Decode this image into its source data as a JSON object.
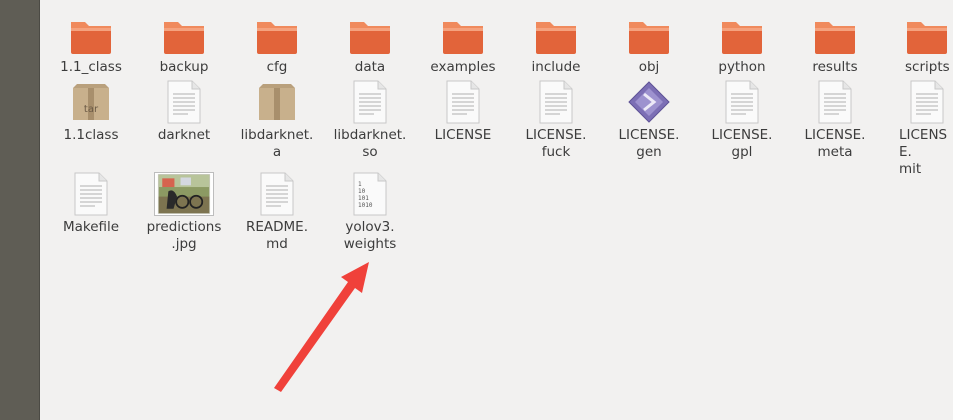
{
  "files": [
    {
      "name": "1.1_class",
      "type": "folder"
    },
    {
      "name": "backup",
      "type": "folder"
    },
    {
      "name": "cfg",
      "type": "folder"
    },
    {
      "name": "data",
      "type": "folder"
    },
    {
      "name": "examples",
      "type": "folder"
    },
    {
      "name": "include",
      "type": "folder"
    },
    {
      "name": "obj",
      "type": "folder"
    },
    {
      "name": "python",
      "type": "folder"
    },
    {
      "name": "results",
      "type": "folder"
    },
    {
      "name": "scripts",
      "type": "folder"
    },
    {
      "name": "1.1class",
      "type": "archive",
      "badge": "tar"
    },
    {
      "name": "darknet",
      "type": "document"
    },
    {
      "name": "libdarknet.\na",
      "type": "archive"
    },
    {
      "name": "libdarknet.\nso",
      "type": "document"
    },
    {
      "name": "LICENSE",
      "type": "document"
    },
    {
      "name": "LICENSE.\nfuck",
      "type": "document"
    },
    {
      "name": "LICENSE.\ngen",
      "type": "diamond"
    },
    {
      "name": "LICENSE.\ngpl",
      "type": "document"
    },
    {
      "name": "LICENSE.\nmeta",
      "type": "document"
    },
    {
      "name": "LICENSE.\nmit",
      "type": "document"
    },
    {
      "name": "Makefile",
      "type": "document"
    },
    {
      "name": "predictions\n.jpg",
      "type": "image"
    },
    {
      "name": "README.\nmd",
      "type": "document"
    },
    {
      "name": "yolov3.\nweights",
      "type": "binary",
      "binary_lines": [
        "1",
        "10",
        "101",
        "1010"
      ]
    }
  ],
  "colors": {
    "folder_body": "#e2643a",
    "folder_tab": "#f08a5d",
    "arrow": "#f0413a"
  }
}
